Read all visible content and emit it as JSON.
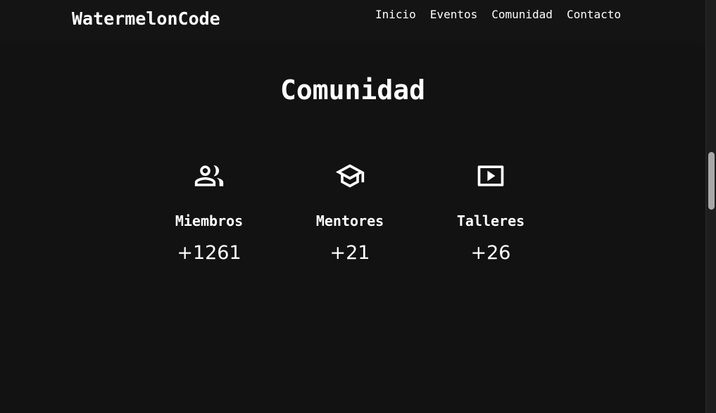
{
  "header": {
    "brand": "WatermelonCode",
    "nav": [
      {
        "label": "Inicio"
      },
      {
        "label": "Eventos"
      },
      {
        "label": "Comunidad"
      },
      {
        "label": "Contacto"
      }
    ]
  },
  "section": {
    "title": "Comunidad",
    "stats": [
      {
        "icon": "people-icon",
        "label": "Miembros",
        "value": "+1261"
      },
      {
        "icon": "graduation-cap-icon",
        "label": "Mentores",
        "value": "+21"
      },
      {
        "icon": "video-play-icon",
        "label": "Talleres",
        "value": "+26"
      }
    ]
  }
}
